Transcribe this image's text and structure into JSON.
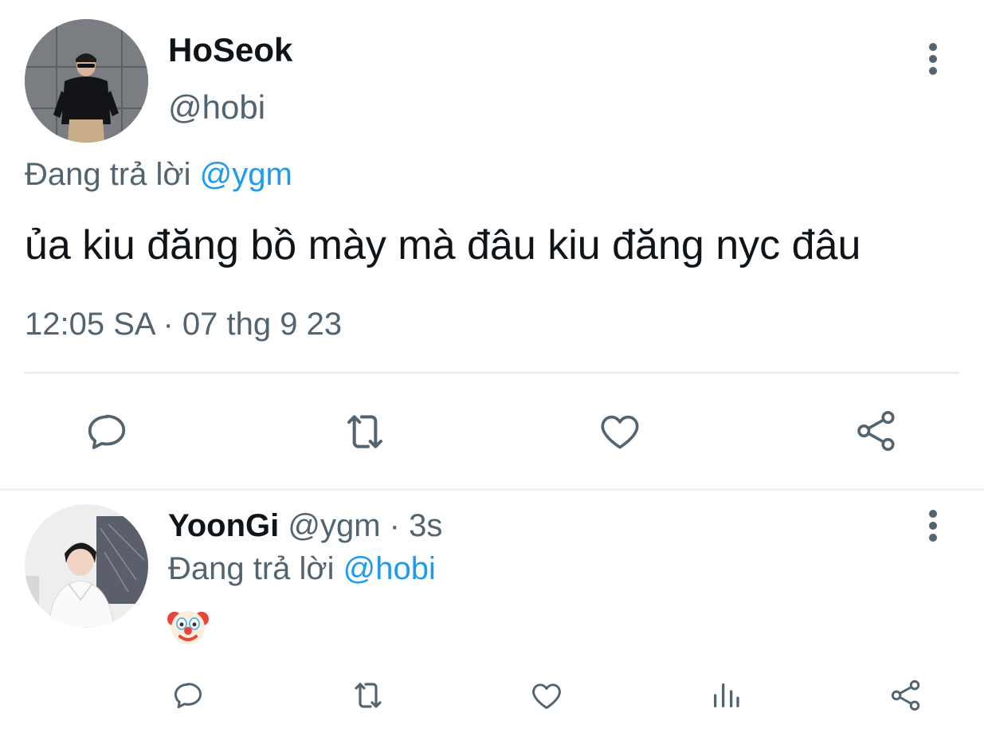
{
  "main_tweet": {
    "author_name": "HoSeok",
    "author_handle": "@hobi",
    "replying_prefix": "Đang trả lời",
    "replying_to": "@ygm",
    "text": "ủa kiu đăng bồ mày mà đâu kiu đăng nyc đâu",
    "timestamp": "12:05 SA · 07 thg 9 23",
    "actions": [
      "reply-icon",
      "retweet-icon",
      "like-icon",
      "share-icon"
    ]
  },
  "reply_tweet": {
    "author_name": "YoonGi",
    "author_handle": "@ygm",
    "separator": "·",
    "age": "3s",
    "replying_prefix": "Đang trả lời",
    "replying_to": "@hobi",
    "content_emoji": "clown-face-emoji",
    "actions": [
      "reply-icon",
      "retweet-icon",
      "like-icon",
      "views-icon",
      "share-icon"
    ]
  },
  "colors": {
    "text_primary": "#0f1419",
    "text_secondary": "#536471",
    "accent": "#1d9bf0",
    "divider": "#e6e9ec"
  }
}
